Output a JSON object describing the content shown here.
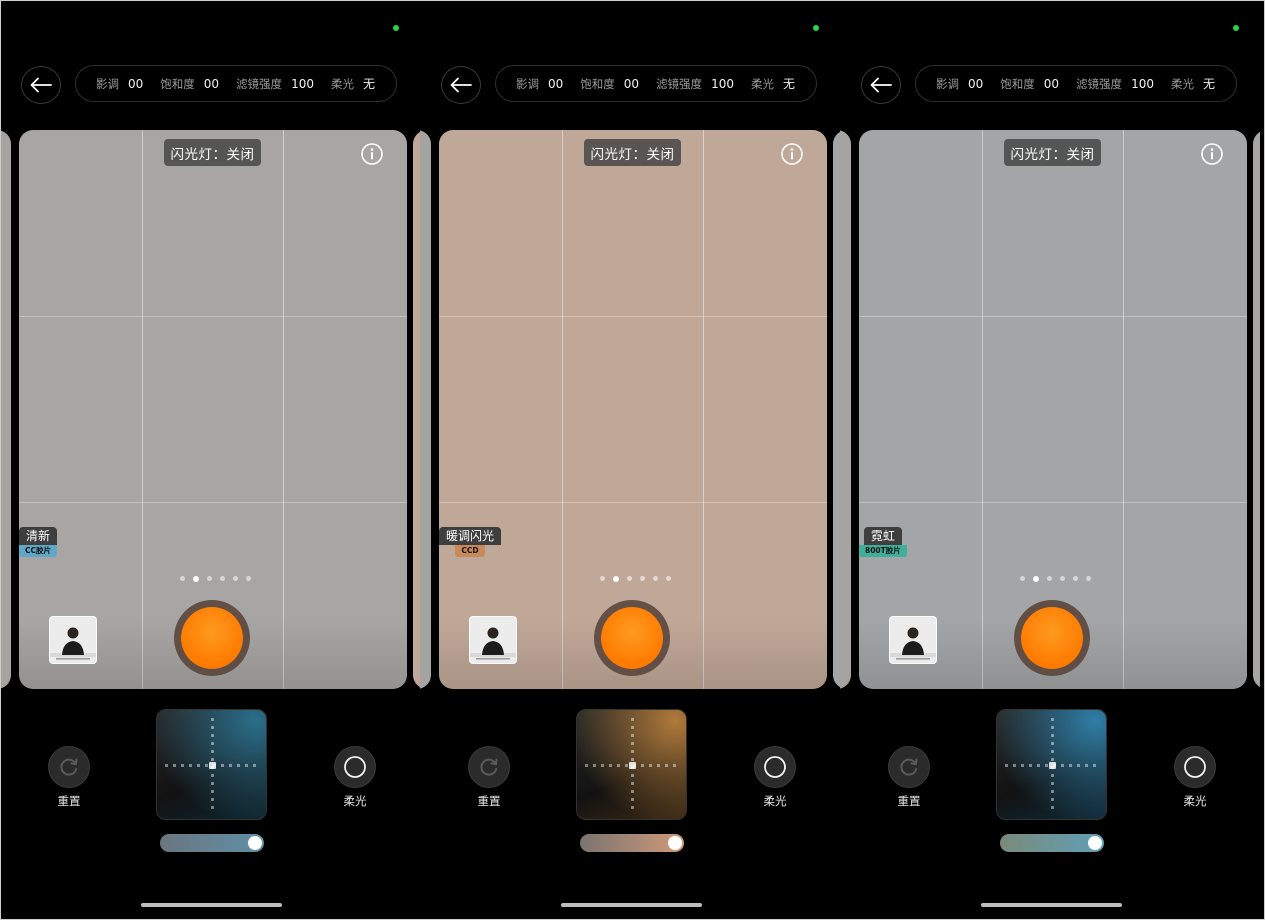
{
  "params": [
    {
      "label": "影调",
      "value": "00"
    },
    {
      "label": "饱和度",
      "value": "00"
    },
    {
      "label": "滤镜强度",
      "value": "100"
    },
    {
      "label": "柔光",
      "value": "无"
    }
  ],
  "flash": "闪光灯：关闭",
  "buttons": {
    "reset": "重置",
    "soft_light": "柔光"
  },
  "panels": [
    {
      "filter_name": "清新",
      "filter_sub": "CC胶片",
      "sub_color": "#5fa8c8",
      "viewfinder_color": "#a8a6a4",
      "pad_tint": "#2a6e8a",
      "slider_start": "#6a7680",
      "slider_end": "#5f8fa6"
    },
    {
      "filter_name": "暖调闪光",
      "filter_sub": "CCD",
      "sub_color": "#c98a5a",
      "viewfinder_color": "#c0a898",
      "pad_tint": "#b07a3a",
      "slider_start": "#7a7470",
      "slider_end": "#d09a78"
    },
    {
      "filter_name": "霓虹",
      "filter_sub": "800T胶片",
      "sub_color": "#3fae9a",
      "viewfinder_color": "#a3a5a7",
      "pad_tint": "#2e7ea6",
      "slider_start": "#7a8a7a",
      "slider_end": "#5fa0b8"
    }
  ]
}
